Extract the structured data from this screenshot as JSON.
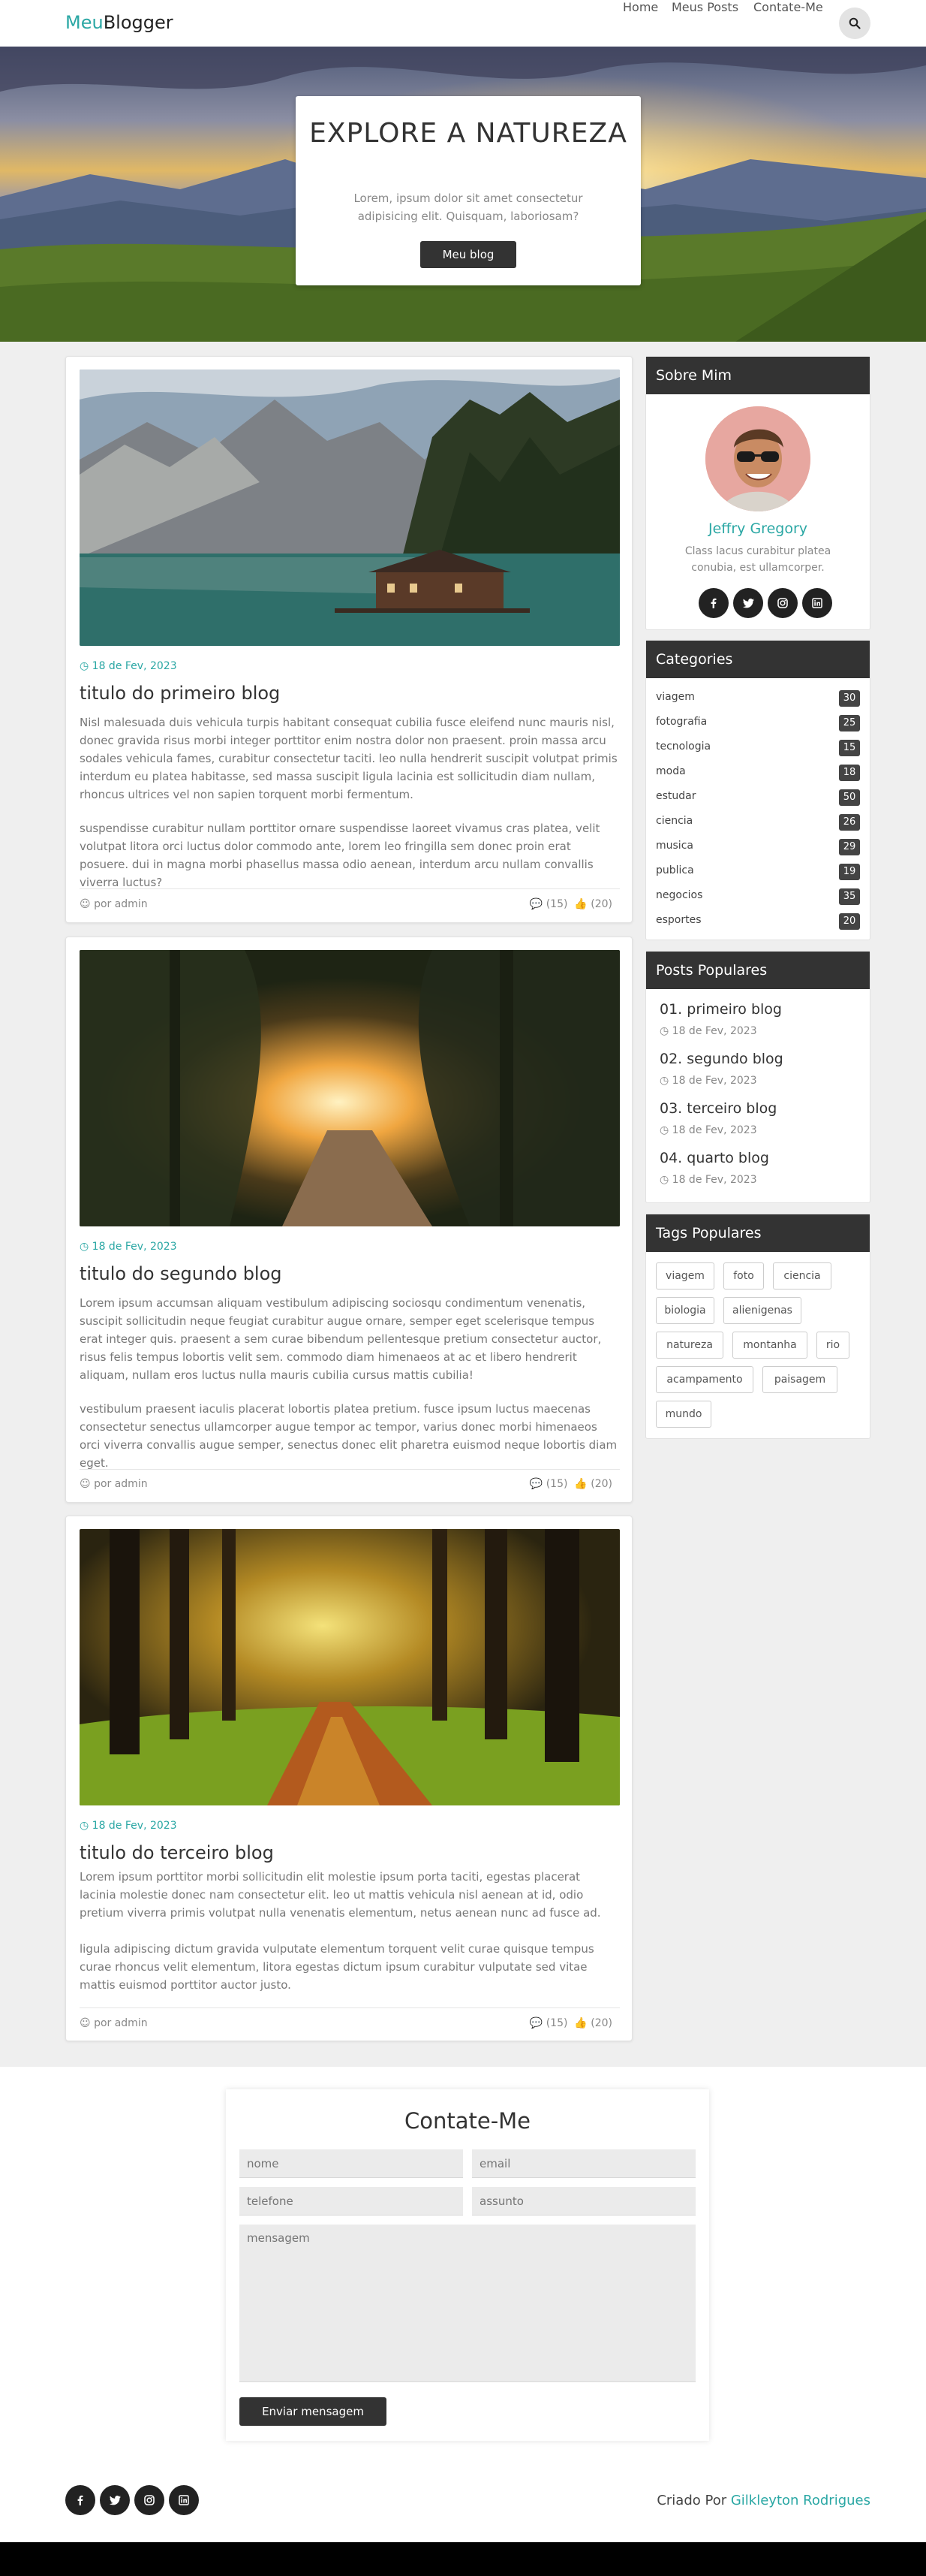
{
  "nav": {
    "brand_accent": "Meu",
    "brand_rest": "Blogger",
    "links": [
      "Home",
      "Meus Posts",
      "Contate-Me"
    ],
    "search_icon": "search-icon"
  },
  "hero": {
    "title": "EXPLORE A NATUREZA",
    "subtitle": "Lorem, ipsum dolor sit amet consectetur adipisicing elit. Quisquam, laboriosam?",
    "button": "Meu blog"
  },
  "posts": [
    {
      "date": "18 de Fev, 2023",
      "title": "titulo do primeiro blog",
      "p1": "Nisl malesuada duis vehicula turpis habitant consequat cubilia fusce eleifend nunc mauris nisl, donec gravida risus morbi integer porttitor enim nostra dolor non praesent. proin massa arcu sodales vehicula fames, curabitur consectetur taciti. leo nulla hendrerit suscipit volutpat primis interdum eu platea habitasse, sed massa suscipit ligula lacinia est sollicitudin diam nullam, rhoncus ultrices vel non sapien torquent morbi fermentum.",
      "p2": "suspendisse curabitur nullam porttitor ornare suspendisse laoreet vivamus cras platea, velit volutpat litora orci luctus dolor commodo ante, lorem leo fringilla sem donec proin erat posuere. dui in magna morbi phasellus massa odio aenean, interdum arcu nullam convallis viverra luctus?",
      "author": "por admin",
      "comments": "(15)",
      "likes": "(20)"
    },
    {
      "date": "18 de Fev, 2023",
      "title": "titulo do segundo blog",
      "p1": "Lorem ipsum accumsan aliquam vestibulum adipiscing sociosqu condimentum venenatis, suscipit sollicitudin neque feugiat curabitur augue ornare, semper eget scelerisque tempus erat integer quis. praesent a sem curae bibendum pellentesque pretium consectetur auctor, risus felis tempus lobortis velit sem. commodo diam himenaeos at ac et libero hendrerit aliquam, nullam eros luctus nulla mauris cubilia cursus mattis cubilia!",
      "p2": "vestibulum praesent iaculis placerat lobortis platea pretium. fusce ipsum luctus maecenas consectetur senectus ullamcorper augue tempor ac tempor, varius donec morbi himenaeos orci viverra convallis augue semper, senectus donec elit pharetra euismod neque lobortis diam eget.",
      "author": "por admin",
      "comments": "(15)",
      "likes": "(20)"
    },
    {
      "date": "18 de Fev, 2023",
      "title": "titulo do terceiro blog",
      "p1": "Lorem ipsum porttitor morbi sollicitudin elit molestie ipsum porta taciti, egestas placerat lacinia molestie donec nam consectetur elit. leo ut mattis vehicula nisl aenean at id, odio pretium viverra primis volutpat nulla venenatis elementum, netus aenean nunc ad fusce ad.",
      "p2": "ligula adipiscing dictum gravida vulputate elementum torquent velit curae quisque tempus curae rhoncus velit elementum, litora egestas dictum ipsum curabitur vulputate sed vitae mattis euismod porttitor auctor justo.",
      "author": "por admin",
      "comments": "(15)",
      "likes": "(20)"
    }
  ],
  "about": {
    "heading": "Sobre Mim",
    "name": "Jeffry Gregory",
    "desc": "Class lacus curabitur platea conubia, est ullamcorper."
  },
  "categories": {
    "heading": "Categories",
    "items": [
      {
        "name": "viagem",
        "count": "30"
      },
      {
        "name": "fotografia",
        "count": "25"
      },
      {
        "name": "tecnologia",
        "count": "15"
      },
      {
        "name": "moda",
        "count": "18"
      },
      {
        "name": "estudar",
        "count": "50"
      },
      {
        "name": "ciencia",
        "count": "26"
      },
      {
        "name": "musica",
        "count": "29"
      },
      {
        "name": "publica",
        "count": "19"
      },
      {
        "name": "negocios",
        "count": "35"
      },
      {
        "name": "esportes",
        "count": "20"
      }
    ]
  },
  "popular_posts": {
    "heading": "Posts Populares",
    "items": [
      {
        "title": "01. primeiro blog",
        "date": "18 de Fev, 2023"
      },
      {
        "title": "02. segundo blog",
        "date": "18 de Fev, 2023"
      },
      {
        "title": "03. terceiro blog",
        "date": "18 de Fev, 2023"
      },
      {
        "title": "04. quarto blog",
        "date": "18 de Fev, 2023"
      }
    ]
  },
  "tags": {
    "heading": "Tags Populares",
    "items": [
      "viagem",
      "foto",
      "ciencia",
      "biologia",
      "alienigenas",
      "natureza",
      "montanha",
      "rio",
      "acampamento",
      "paisagem",
      "mundo"
    ]
  },
  "contact": {
    "title": "Contate-Me",
    "name_placeholder": "nome",
    "email_placeholder": "email",
    "phone_placeholder": "telefone",
    "subject_placeholder": "assunto",
    "message_placeholder": "mensagem",
    "submit": "Enviar mensagem"
  },
  "footer": {
    "credit_prefix": "Criado Por",
    "credit_name": "Gilkleyton Rodrigues"
  },
  "colors": {
    "accent": "#2aa7a4",
    "dark": "#333333",
    "page_bg": "#efefef"
  },
  "social_icons": [
    "facebook-icon",
    "twitter-icon",
    "instagram-icon",
    "linkedin-icon"
  ]
}
